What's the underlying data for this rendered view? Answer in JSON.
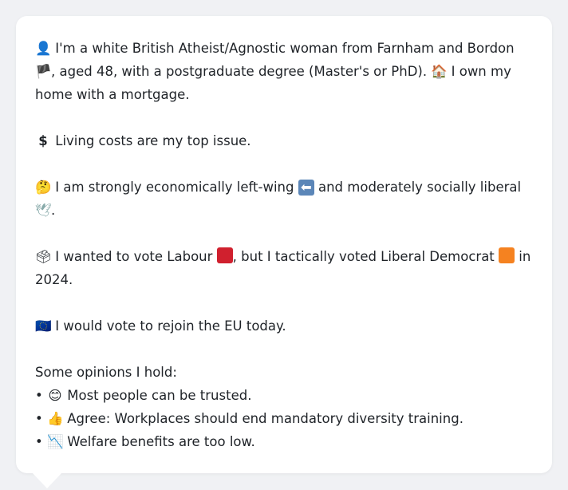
{
  "profile": {
    "intro": {
      "icon": "👤",
      "text_a": "I'm a white British Atheist/Agnostic woman from Farnham and Bordon",
      "flag": "🏴",
      "text_b": ", aged 48, with a postgraduate degree (Master's or PhD).",
      "home_icon": "🏠",
      "text_c": "I own my home with a mortgage."
    },
    "issue": {
      "icon": "$",
      "text": "Living costs are my top issue."
    },
    "ideology": {
      "icon": "🤔",
      "text_a": "I am strongly economically left-wing",
      "left_icon": "⬅",
      "text_b": "and moderately socially liberal",
      "dove_icon": "🕊",
      "text_c": "."
    },
    "vote": {
      "icon": "🗳",
      "text_a": "I wanted to vote Labour",
      "text_b": ", but I tactically voted Liberal Democrat",
      "text_c": "in 2024.",
      "labour_color": "#d0202e",
      "libdem_color": "#f58220"
    },
    "eu": {
      "icon": "🇪🇺",
      "text": "I would vote to rejoin the EU today."
    },
    "opinions_title": "Some opinions I hold:",
    "opinions": [
      {
        "bullet": "•",
        "icon": "😊",
        "text": "Most people can be trusted."
      },
      {
        "bullet": "•",
        "icon": "👍",
        "text": "Agree: Workplaces should end mandatory diversity training."
      },
      {
        "bullet": "•",
        "icon": "📉",
        "text": "Welfare benefits are too low."
      }
    ]
  }
}
